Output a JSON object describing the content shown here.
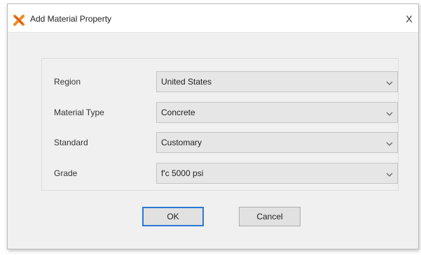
{
  "dialog": {
    "title": "Add Material Property",
    "close_glyph": "X",
    "icon": "app-logo-icon"
  },
  "fields": [
    {
      "label": "Region",
      "value": "United States"
    },
    {
      "label": "Material Type",
      "value": "Concrete"
    },
    {
      "label": "Standard",
      "value": "Customary"
    },
    {
      "label": "Grade",
      "value": "f'c 5000 psi"
    }
  ],
  "buttons": {
    "ok_label": "OK",
    "cancel_label": "Cancel"
  },
  "colors": {
    "default_button_border": "#2b79d6",
    "icon_orange": "#f08a1c",
    "icon_red": "#d23b2b"
  }
}
